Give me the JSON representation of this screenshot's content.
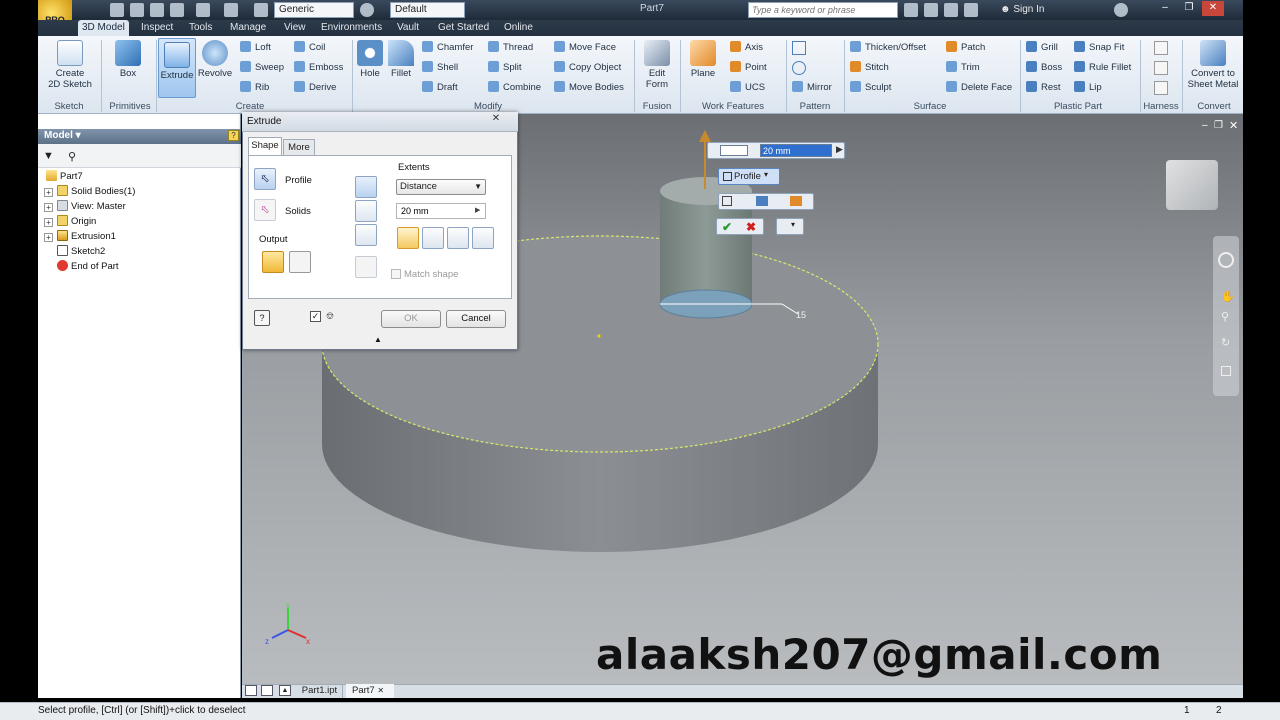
{
  "app": {
    "title": "Part7",
    "logo": "PRO"
  },
  "qat": {
    "material_combo": "Generic",
    "appearance_combo": "Default"
  },
  "search": {
    "placeholder": "Type a keyword or phrase"
  },
  "account": {
    "sign_in": "Sign In"
  },
  "tabs": [
    "3D Model",
    "Inspect",
    "Tools",
    "Manage",
    "View",
    "Environments",
    "Vault",
    "Get Started",
    "Online"
  ],
  "ribbon": {
    "sketch": {
      "create_2d_sketch": [
        "Create",
        "2D Sketch"
      ],
      "group": "Sketch"
    },
    "primitives": {
      "box": "Box",
      "group": "Primitives"
    },
    "create": {
      "extrude": "Extrude",
      "revolve": "Revolve",
      "loft": "Loft",
      "sweep": "Sweep",
      "rib": "Rib",
      "coil": "Coil",
      "emboss": "Emboss",
      "derive": "Derive",
      "group": "Create"
    },
    "modify": {
      "hole": "Hole",
      "fillet": "Fillet",
      "chamfer": "Chamfer",
      "shell": "Shell",
      "draft": "Draft",
      "thread": "Thread",
      "split": "Split",
      "combine": "Combine",
      "move_face": "Move Face",
      "copy_object": "Copy Object",
      "move_bodies": "Move Bodies",
      "group": "Modify"
    },
    "fusion": {
      "edit_form": [
        "Edit",
        "Form"
      ],
      "group": "Fusion"
    },
    "work_features": {
      "plane": "Plane",
      "axis": "Axis",
      "point": "Point",
      "ucs": "UCS",
      "group": "Work Features"
    },
    "pattern": {
      "mirror": "Mirror",
      "group": "Pattern"
    },
    "surface": {
      "thicken_offset": "Thicken/Offset",
      "stitch": "Stitch",
      "sculpt": "Sculpt",
      "patch": "Patch",
      "trim": "Trim",
      "delete_face": "Delete Face",
      "group": "Surface"
    },
    "plastic_part": {
      "grill": "Grill",
      "boss": "Boss",
      "rest": "Rest",
      "snap_fit": "Snap Fit",
      "rule_fillet": "Rule Fillet",
      "lip": "Lip",
      "group": "Plastic Part"
    },
    "harness": {
      "group": "Harness"
    },
    "convert": {
      "convert_to_sheet_metal": [
        "Convert to",
        "Sheet Metal"
      ],
      "group": "Convert"
    }
  },
  "browser": {
    "title": "Model",
    "tree": [
      {
        "label": "Part7",
        "expander": ""
      },
      {
        "label": "Solid Bodies(1)",
        "expander": "+"
      },
      {
        "label": "View: Master",
        "expander": "+"
      },
      {
        "label": "Origin",
        "expander": "+"
      },
      {
        "label": "Extrusion1",
        "expander": "+"
      },
      {
        "label": "Sketch2",
        "expander": ""
      },
      {
        "label": "End of Part",
        "expander": ""
      }
    ]
  },
  "dialog": {
    "title": "Extrude",
    "tabs": [
      "Shape",
      "More"
    ],
    "profile_label": "Profile",
    "solids_label": "Solids",
    "output_label": "Output",
    "extents_label": "Extents",
    "extents_type": "Distance",
    "distance_value": "20 mm",
    "match_shape": "Match shape",
    "ok": "OK",
    "cancel": "Cancel"
  },
  "heads_up": {
    "distance_value": "20 mm",
    "profile_label": "Profile"
  },
  "viewport": {
    "dimension_label": "15"
  },
  "doc_tabs": [
    "Part1.ipt",
    "Part7"
  ],
  "status": {
    "prompt": "Select profile, [Ctrl] (or [Shift])+click to deselect",
    "count1": "1",
    "count2": "2"
  },
  "watermark": {
    "email": "alaaksh207@gmail.com"
  },
  "colors": {
    "accent": "#3a78c8",
    "ribbon": "#e4ebf3",
    "viewport_top": "#6b6f73",
    "model_face": "#8d9196",
    "selection_edge": "#d8e86a"
  }
}
